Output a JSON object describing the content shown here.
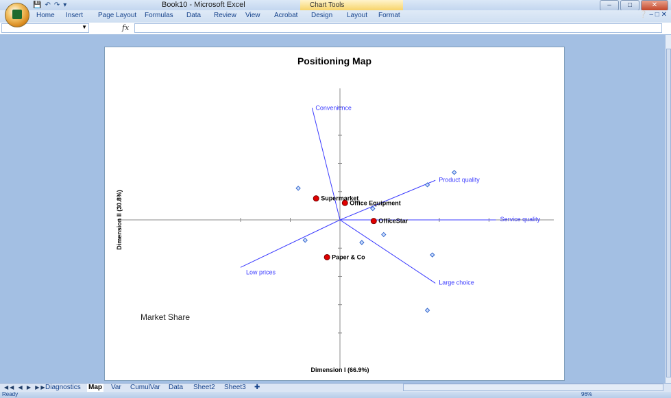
{
  "window": {
    "title": "Book10 - Microsoft Excel",
    "context_tab": "Chart Tools",
    "controls": [
      "minimize",
      "maximize",
      "close"
    ]
  },
  "ribbon": {
    "tabs": [
      "Home",
      "Insert",
      "Page Layout",
      "Formulas",
      "Data",
      "Review",
      "View",
      "Acrobat",
      "Design",
      "Layout",
      "Format"
    ]
  },
  "formula_bar": {
    "name_box": "",
    "fx_label": "fx",
    "formula": ""
  },
  "chart": {
    "title": "Positioning Map",
    "xlabel": "Dimension I (66.9%)",
    "ylabel": "Dimension II (30.8%)",
    "text_box": "Market Share"
  },
  "chart_data": {
    "type": "scatter",
    "title": "Positioning Map",
    "xlabel": "Dimension I (66.9%)",
    "ylabel": "Dimension II (30.8%)",
    "xlim": [
      -1,
      1
    ],
    "ylim": [
      -1,
      1
    ],
    "grid": false,
    "series": [
      {
        "name": "",
        "style": "red-circle",
        "points": [
          {
            "label": "Supermarket",
            "x": -0.24,
            "y": 0.19
          },
          {
            "label": "Office Equipment",
            "x": 0.05,
            "y": 0.15
          },
          {
            "label": "OfficeStar",
            "x": 0.34,
            "y": -0.01
          },
          {
            "label": "Paper & Co",
            "x": -0.13,
            "y": -0.33
          }
        ]
      },
      {
        "name": "",
        "style": "blue-diamond",
        "points": [
          {
            "x": -0.42,
            "y": 0.28
          },
          {
            "x": -0.35,
            "y": -0.18
          },
          {
            "x": 0.33,
            "y": 0.1
          },
          {
            "x": 0.22,
            "y": -0.2
          },
          {
            "x": 0.44,
            "y": -0.13
          },
          {
            "x": 0.88,
            "y": 0.31
          },
          {
            "x": 1.15,
            "y": 0.42
          },
          {
            "x": 0.93,
            "y": -0.31
          },
          {
            "x": 0.88,
            "y": -0.8
          }
        ]
      },
      {
        "name": "",
        "style": "blue-vector",
        "vectors": [
          {
            "label": "Convenience",
            "x": -0.28,
            "y": 0.99
          },
          {
            "label": "Product quality",
            "x": 0.96,
            "y": 0.35
          },
          {
            "label": "Service quality",
            "x": 1.57,
            "y": 0.0
          },
          {
            "label": "Large choice",
            "x": 0.96,
            "y": -0.56
          },
          {
            "label": "Low prices",
            "x": -1.0,
            "y": -0.42
          }
        ]
      }
    ]
  },
  "sheets": {
    "tabs": [
      "Diagnostics",
      "Map",
      "Var",
      "CumulVar",
      "Data",
      "Sheet2",
      "Sheet3"
    ],
    "active": "Map"
  },
  "status": {
    "text": "Ready",
    "zoom": "96%"
  }
}
